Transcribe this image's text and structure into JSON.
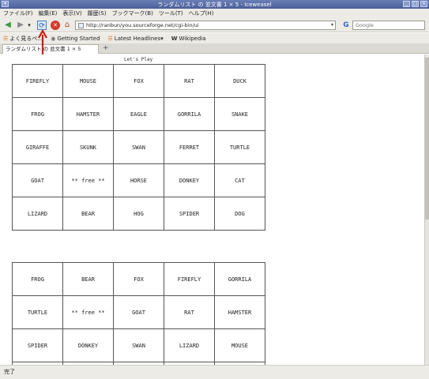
{
  "window": {
    "title": "ランダムリスト の 並文書 1 × 5 - Iceweasel",
    "controls_left": [
      "▾"
    ],
    "controls_right": [
      "_",
      "□",
      "×"
    ]
  },
  "menu": [
    "ファイル(F)",
    "編集(E)",
    "表示(V)",
    "履歴(S)",
    "ブックマーク(B)",
    "ツール(T)",
    "ヘルプ(H)"
  ],
  "nav": {
    "back": "◀",
    "forward": "▶",
    "dropdown": "▾",
    "reload": "⟳",
    "stop": "✕",
    "home": "⌂",
    "url": "http://ranbun/you.sourceforge.net/cgi-bin/ui",
    "search_engine": "G",
    "search_placeholder": "Google"
  },
  "bookmarks": [
    {
      "label": "よく見るペ…",
      "icon": "rss-icon"
    },
    {
      "label": "Getting Started",
      "icon": "page-icon"
    },
    {
      "label": "Latest Headlines▾",
      "icon": "rss-icon"
    },
    {
      "label": "Wikipedia",
      "icon": "wikipedia-icon"
    }
  ],
  "tab": {
    "label": "ランダムリスト の 並文書 1 × 5",
    "new_tab": "+"
  },
  "page": {
    "caption": "Let's Play",
    "board1": [
      [
        "FIREFLY",
        "MOUSE",
        "FOX",
        "RAT",
        "DUCK"
      ],
      [
        "FROG",
        "HAMSTER",
        "EAGLE",
        "GORRILA",
        "SNAKE"
      ],
      [
        "GIRAFFE",
        "SKUNK",
        "SWAN",
        "FERRET",
        "TURTLE"
      ],
      [
        "GOAT",
        "** free **",
        "HORSE",
        "DONKEY",
        "CAT"
      ],
      [
        "LIZARD",
        "BEAR",
        "HOG",
        "SPIDER",
        "DOG"
      ]
    ],
    "board2": [
      [
        "FROG",
        "BEAR",
        "FOX",
        "FIREFLY",
        "GORRILA"
      ],
      [
        "TURTLE",
        "** free **",
        "GOAT",
        "RAT",
        "HAMSTER"
      ],
      [
        "SPIDER",
        "DONKEY",
        "SWAN",
        "LIZARD",
        "MOUSE"
      ],
      [
        "",
        "",
        "",
        "",
        ""
      ]
    ]
  },
  "status": "完了"
}
